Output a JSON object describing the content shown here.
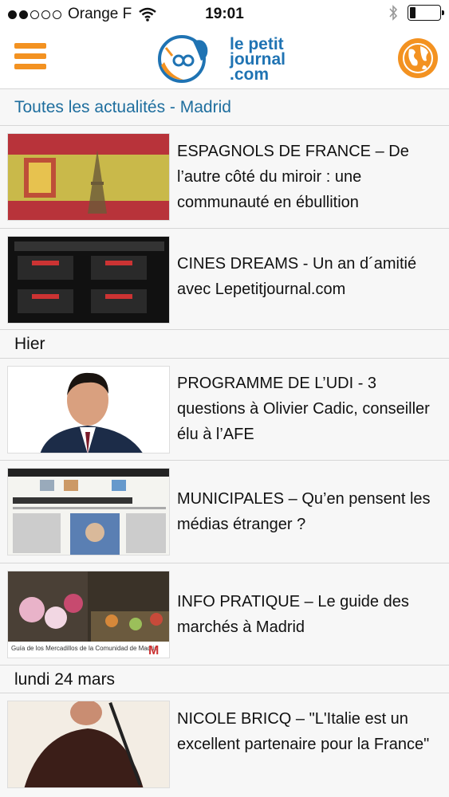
{
  "status_bar": {
    "carrier": "Orange F",
    "time": "19:01",
    "signal_bars_filled": 2,
    "signal_bars_total": 5,
    "battery_level": 0.2
  },
  "header": {
    "logo_line1": "le petit",
    "logo_line2": "journal",
    "logo_line3": ".com",
    "brand_color": "#f39221",
    "logo_color": "#1f73b3"
  },
  "section": {
    "title": "Toutes les actualités - Madrid"
  },
  "articles": [
    {
      "title": "ESPAGNOLS DE FRANCE – De l’autre côté du miroir : une communauté en ébullition"
    },
    {
      "title": "CINES DREAMS - Un an d´amitié avec Lepetitjournal.com"
    },
    {
      "title": "PROGRAMME DE L’UDI - 3 questions à Olivier Cadic, conseiller élu à l’AFE"
    },
    {
      "title": "MUNICIPALES – Qu’en pensent les médias étranger ?"
    },
    {
      "title": "INFO PRATIQUE – Le guide des marchés à Madrid"
    },
    {
      "title": "NICOLE BRICQ – \"L'Italie est un excellent partenaire pour la France\""
    }
  ],
  "date_separators": [
    {
      "label": "Hier"
    },
    {
      "label": "lundi 24 mars"
    }
  ],
  "thumbnails": {
    "market_caption": "Guía de los Mercadillos de la Comunidad de Madrid",
    "market_logo": "M"
  }
}
